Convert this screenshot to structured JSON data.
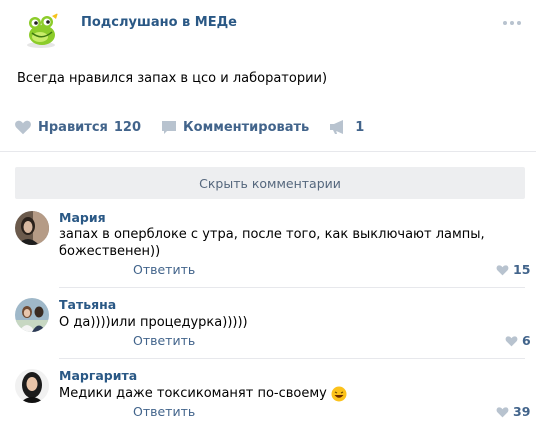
{
  "post": {
    "group_name": "Подслушано в МЕДе",
    "text": "Всегда нравился запах в цсо и лаборатории)",
    "like_label": "Нравится",
    "like_count": "120",
    "comment_label": "Комментировать",
    "share_count": "1"
  },
  "comments_toggle": "Скрыть комментарии",
  "comments": [
    {
      "author": "Мария",
      "text_line1": "запах в оперблоке с утра, после того, как выключают лампы,",
      "text_line2": "божественен))",
      "reply": "Ответить",
      "likes": "15"
    },
    {
      "author": "Татьяна",
      "text_line1": "О да))))или процедурка)))))",
      "reply": "Ответить",
      "likes": "6"
    },
    {
      "author": "Маргарита",
      "text_line1": "Медики даже токсикоманят по-своему",
      "reply": "Ответить",
      "likes": "39"
    }
  ],
  "colors": {
    "link": "#2a5885",
    "action": "#42648b",
    "icon": "#b8c3cf",
    "bar": "#edeef0"
  }
}
